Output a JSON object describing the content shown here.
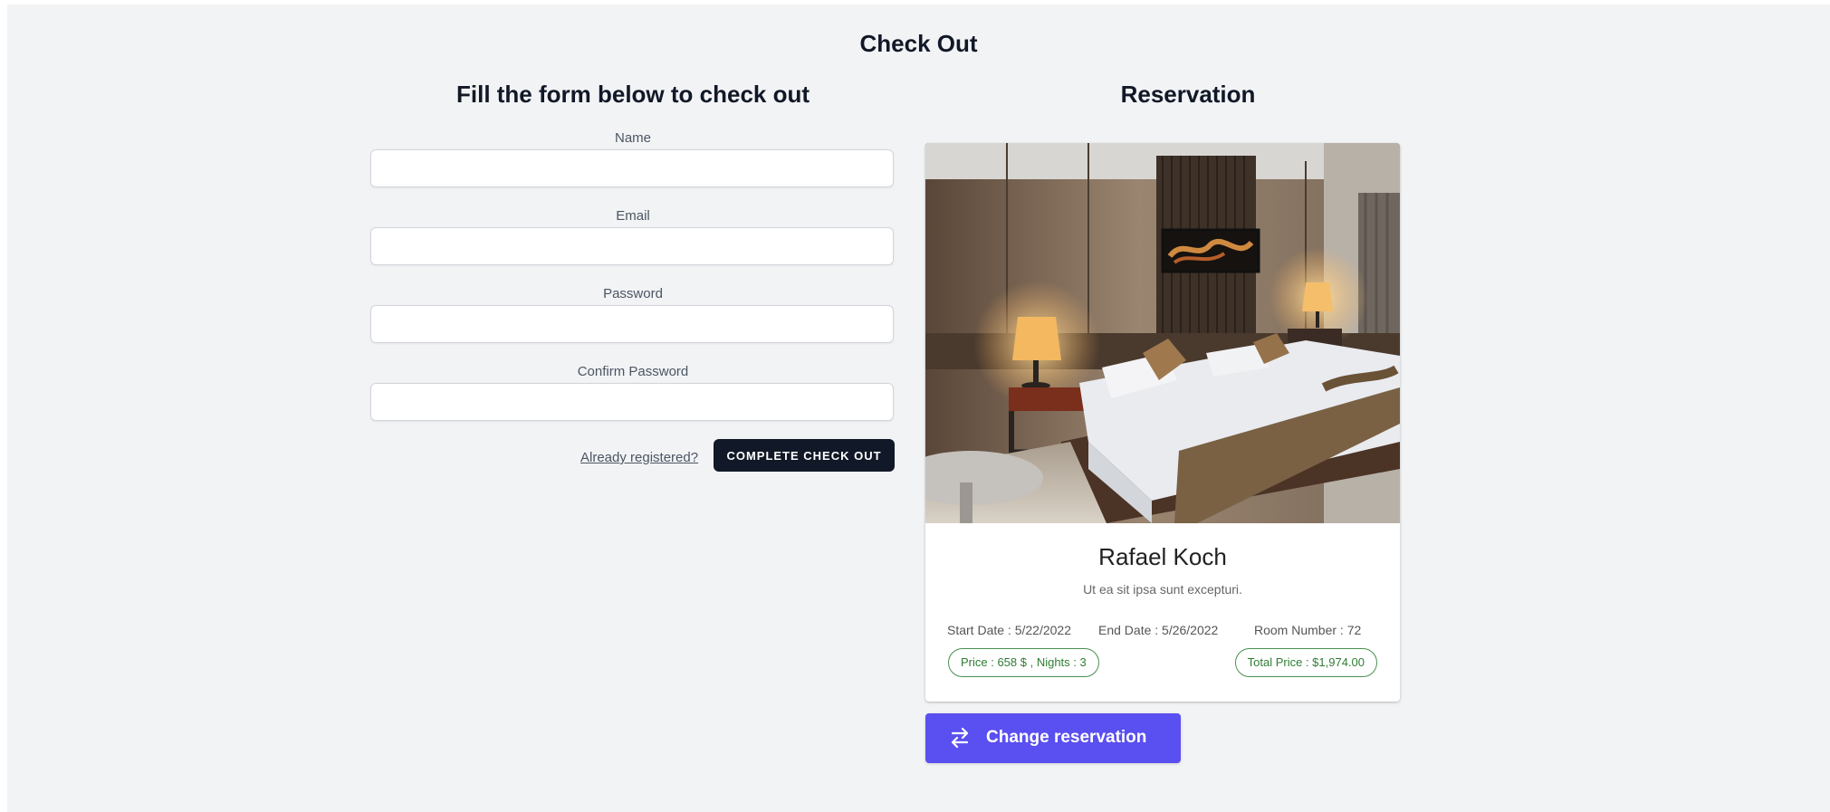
{
  "page": {
    "title": "Check Out"
  },
  "form": {
    "title": "Fill the form below to check out",
    "fields": [
      {
        "label": "Name",
        "value": "",
        "placeholder": ""
      },
      {
        "label": "Email",
        "value": "",
        "placeholder": ""
      },
      {
        "label": "Password",
        "value": "",
        "placeholder": ""
      },
      {
        "label": "Confirm Password",
        "value": "",
        "placeholder": ""
      }
    ],
    "login_link": "Already registered?",
    "submit_label": "COMPLETE CHECK OUT"
  },
  "reservation": {
    "title": "Reservation",
    "image_icon": "hotel-room-photo",
    "guest_name": "Rafael Koch",
    "description": "Ut ea sit ipsa sunt excepturi.",
    "start_date": "Start Date : 5/22/2022",
    "end_date": "End Date : 5/26/2022",
    "room_number": "Room Number : 72",
    "price_chip": "Price : 658 $ , Nights : 3",
    "total_chip": "Total Price : $1,974.00",
    "change_button": "Change reservation",
    "change_icon": "swap-arrows-icon"
  },
  "colors": {
    "background": "#f2f3f5",
    "primary_dark": "#111827",
    "accent": "#5a4ff0",
    "chip_green": "#2e7d32"
  }
}
